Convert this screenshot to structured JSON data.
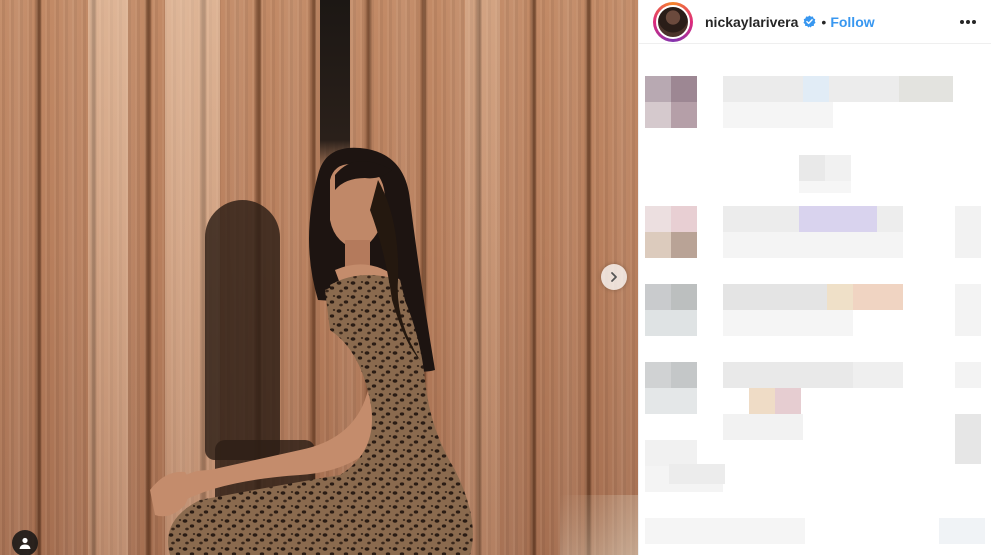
{
  "post": {
    "username": "nickaylarivera",
    "separator": "•",
    "follow_label": "Follow"
  },
  "icons": {
    "verified": "verified-badge-icon",
    "more": "more-options-icon",
    "next": "chevron-right-icon",
    "tag": "user-tag-icon"
  },
  "colors": {
    "follow": "#3897f0",
    "username": "#262626",
    "verified": "#3897f0"
  }
}
